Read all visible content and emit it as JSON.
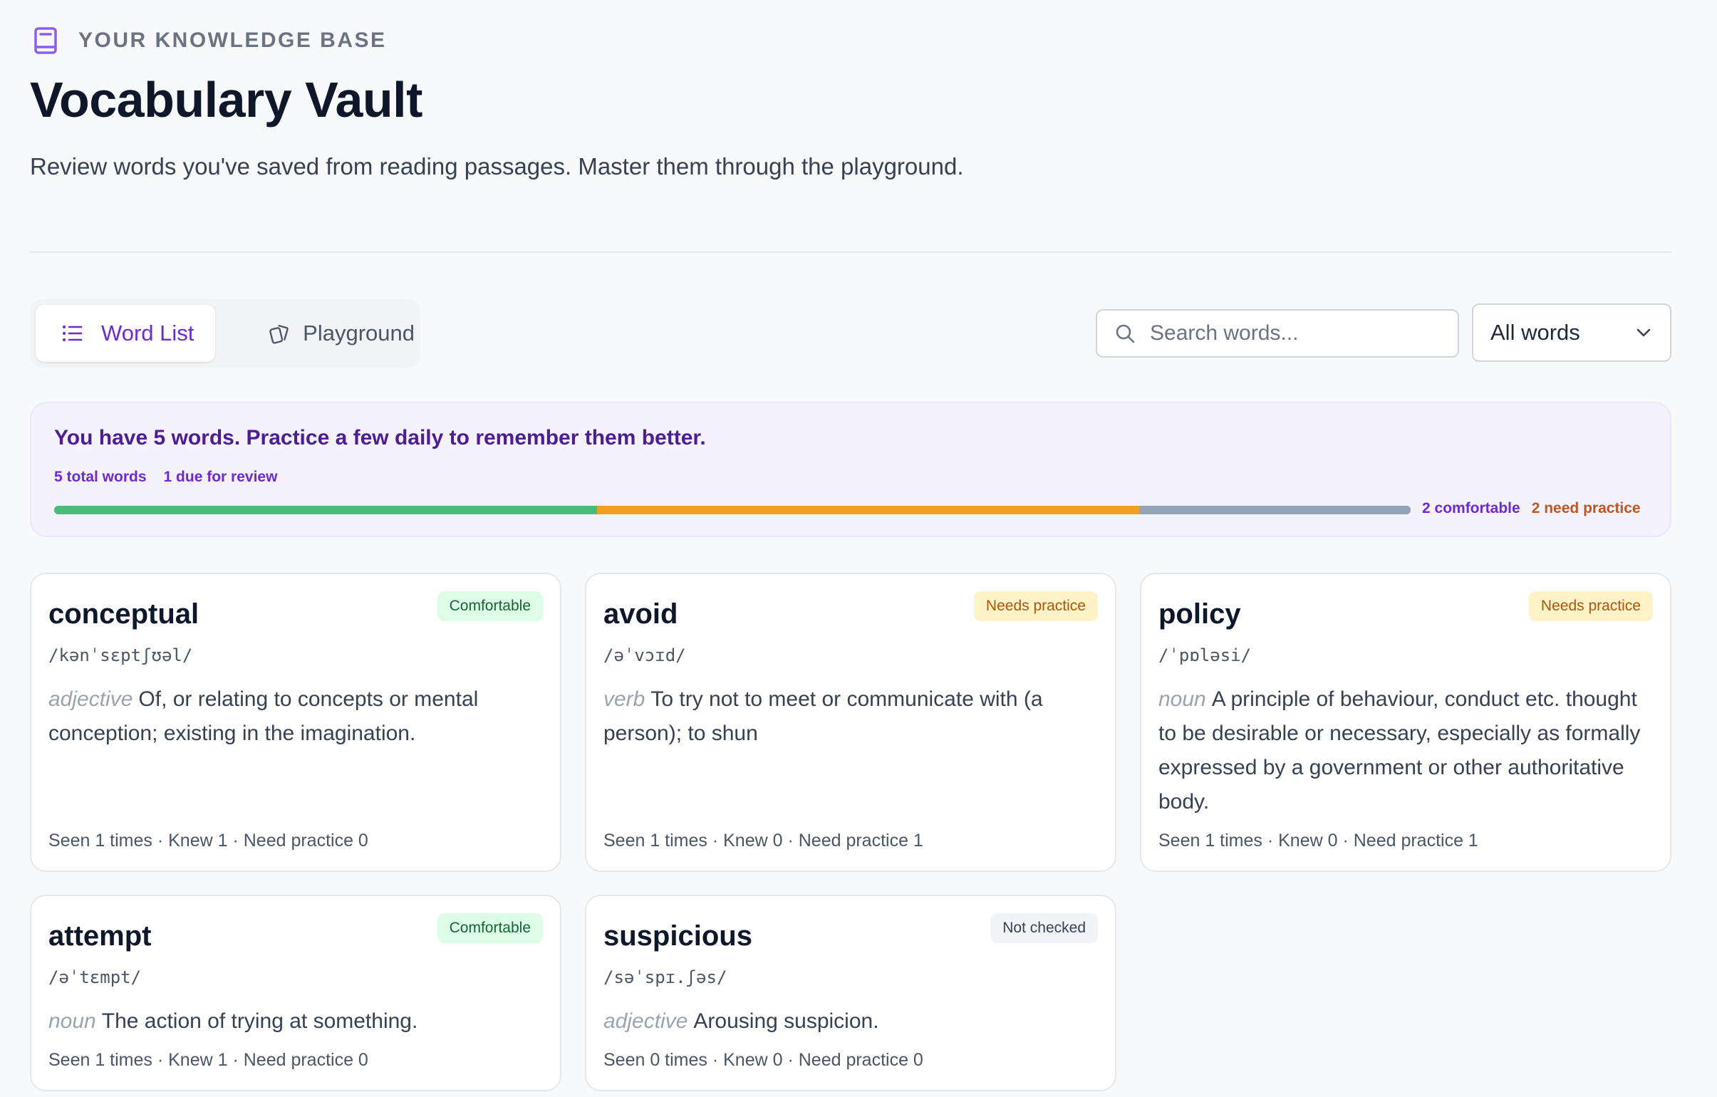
{
  "header": {
    "eyebrow": "YOUR KNOWLEDGE BASE",
    "title": "Vocabulary Vault",
    "subtitle": "Review words you've saved from reading passages. Master them through the playground.",
    "icon": "book-icon"
  },
  "tabs": [
    {
      "label": "Word List",
      "icon": "list-icon",
      "active": true
    },
    {
      "label": "Playground",
      "icon": "cards-icon",
      "active": false
    }
  ],
  "search": {
    "placeholder": "Search words...",
    "value": ""
  },
  "filter": {
    "selected": "All words"
  },
  "summary": {
    "message": "You have 5 words. Practice a few daily to remember them better.",
    "total": "5 total words",
    "due": "1 due for review",
    "comfortable_label": "2 comfortable",
    "needs_label": "2 need practice",
    "progress": {
      "comfortable": 2,
      "needs_practice": 2,
      "not_checked": 1,
      "total": 5
    },
    "colors": {
      "comfortable": "#48bb78",
      "needs_practice": "#f0a020",
      "not_checked": "#94a3b8"
    }
  },
  "words": [
    {
      "word": "conceptual",
      "status": "Comfortable",
      "ipa": "/kənˈsɛptʃʊəl/",
      "pos": "adjective",
      "definition": "Of, or relating to concepts or mental conception; existing in the imagination.",
      "meta": "Seen 1 times · Knew 1 · Need practice 0"
    },
    {
      "word": "avoid",
      "status": "Needs practice",
      "ipa": "/əˈvɔɪd/",
      "pos": "verb",
      "definition": "To try not to meet or communicate with (a person); to shun",
      "meta": "Seen 1 times · Knew 0 · Need practice 1"
    },
    {
      "word": "policy",
      "status": "Needs practice",
      "ipa": "/ˈpɒləsi/",
      "pos": "noun",
      "definition": "A principle of behaviour, conduct etc. thought to be desirable or necessary, especially as formally expressed by a government or other authoritative body.",
      "meta": "Seen 1 times · Knew 0 · Need practice 1"
    },
    {
      "word": "attempt",
      "status": "Comfortable",
      "ipa": "/əˈtɛmpt/",
      "pos": "noun",
      "definition": "The action of trying at something.",
      "meta": "Seen 1 times · Knew 1 · Need practice 0"
    },
    {
      "word": "suspicious",
      "status": "Not checked",
      "ipa": "/səˈspɪ.ʃəs/",
      "pos": "adjective",
      "definition": "Arousing suspicion.",
      "meta": "Seen 0 times · Knew 0 · Need practice 0"
    }
  ]
}
